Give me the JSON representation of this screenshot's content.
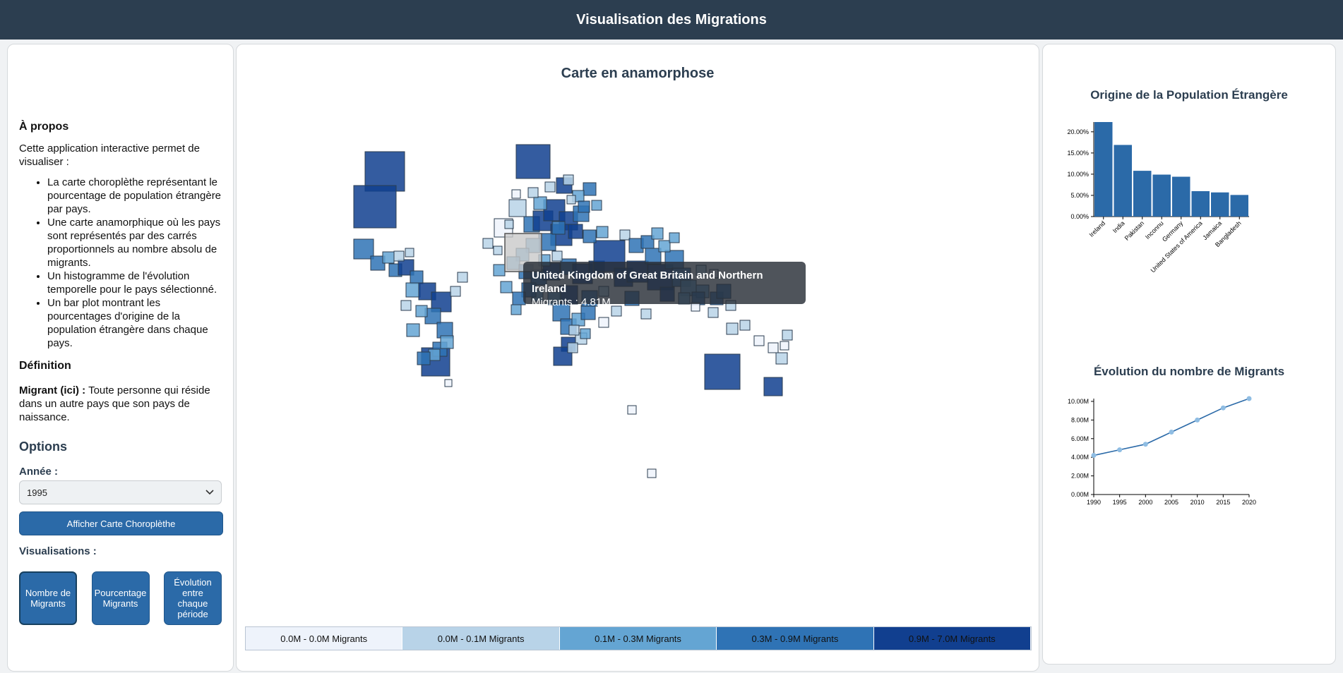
{
  "header": {
    "title": "Visualisation des Migrations"
  },
  "about": {
    "title": "À propos",
    "intro": "Cette application interactive permet de visualiser :",
    "items": [
      "La carte choroplèthe représentant le pourcentage de population étrangère par pays.",
      "Une carte anamorphique où les pays sont représentés par des carrés proportionnels au nombre absolu de migrants.",
      "Un histogramme de l'évolution temporelle pour le pays sélectionné.",
      "Un bar plot montrant les pourcentages d'origine de la population étrangère dans chaque pays."
    ],
    "definition_title": "Définition",
    "definition_term": "Migrant (ici) :",
    "definition_text": " Toute personne qui réside dans un autre pays que son pays de naissance."
  },
  "options": {
    "title": "Options",
    "year_label": "Année :",
    "year_value": "1995",
    "choropleth_button": "Afficher Carte Choroplèthe",
    "vis_label": "Visualisations :",
    "vis_buttons": [
      "Nombre de Migrants",
      "Pourcentage Migrants",
      "Évolution entre chaque période"
    ]
  },
  "map": {
    "title": "Carte en anamorphose",
    "tooltip_country": "United Kingdom of Great Britain and Northern Ireland",
    "tooltip_value": "Migrants : 4.81M",
    "legend": [
      {
        "label": "0.0M - 0.0M Migrants",
        "color": "#eef3fb"
      },
      {
        "label": "0.0M - 0.1M Migrants",
        "color": "#b8d3e8"
      },
      {
        "label": "0.1M - 0.3M Migrants",
        "color": "#64a5d3"
      },
      {
        "label": "0.3M - 0.9M Migrants",
        "color": "#2f73b5"
      },
      {
        "label": "0.9M - 7.0M Migrants",
        "color": "#113f8f"
      }
    ]
  },
  "chart_data": [
    {
      "type": "bar",
      "title": "Origine de la Population Étrangère",
      "categories": [
        "Ireland",
        "India",
        "Pakistan",
        "Inconnu",
        "Germany",
        "United States of America",
        "Jamaica",
        "Bangladesh"
      ],
      "values": [
        22.3,
        16.9,
        10.8,
        9.9,
        9.4,
        6.0,
        5.7,
        5.1
      ],
      "ylim": [
        0,
        22.3
      ],
      "yticks": [
        "0.00%",
        "5.00%",
        "10.00%",
        "15.00%",
        "20.00%"
      ],
      "color": "#2b6aa8"
    },
    {
      "type": "line",
      "title": "Évolution du nombre de Migrants",
      "x": [
        1990,
        1995,
        2000,
        2005,
        2010,
        2015,
        2020
      ],
      "values": [
        4.2,
        4.8,
        5.4,
        6.7,
        8.0,
        9.3,
        10.3
      ],
      "ylim": [
        0,
        10.3
      ],
      "yticks": [
        "0.00M",
        "2.00M",
        "4.00M",
        "6.00M",
        "8.00M",
        "10.00M"
      ],
      "color": "#2b6aa8",
      "point_color": "#8fbde3"
    }
  ]
}
